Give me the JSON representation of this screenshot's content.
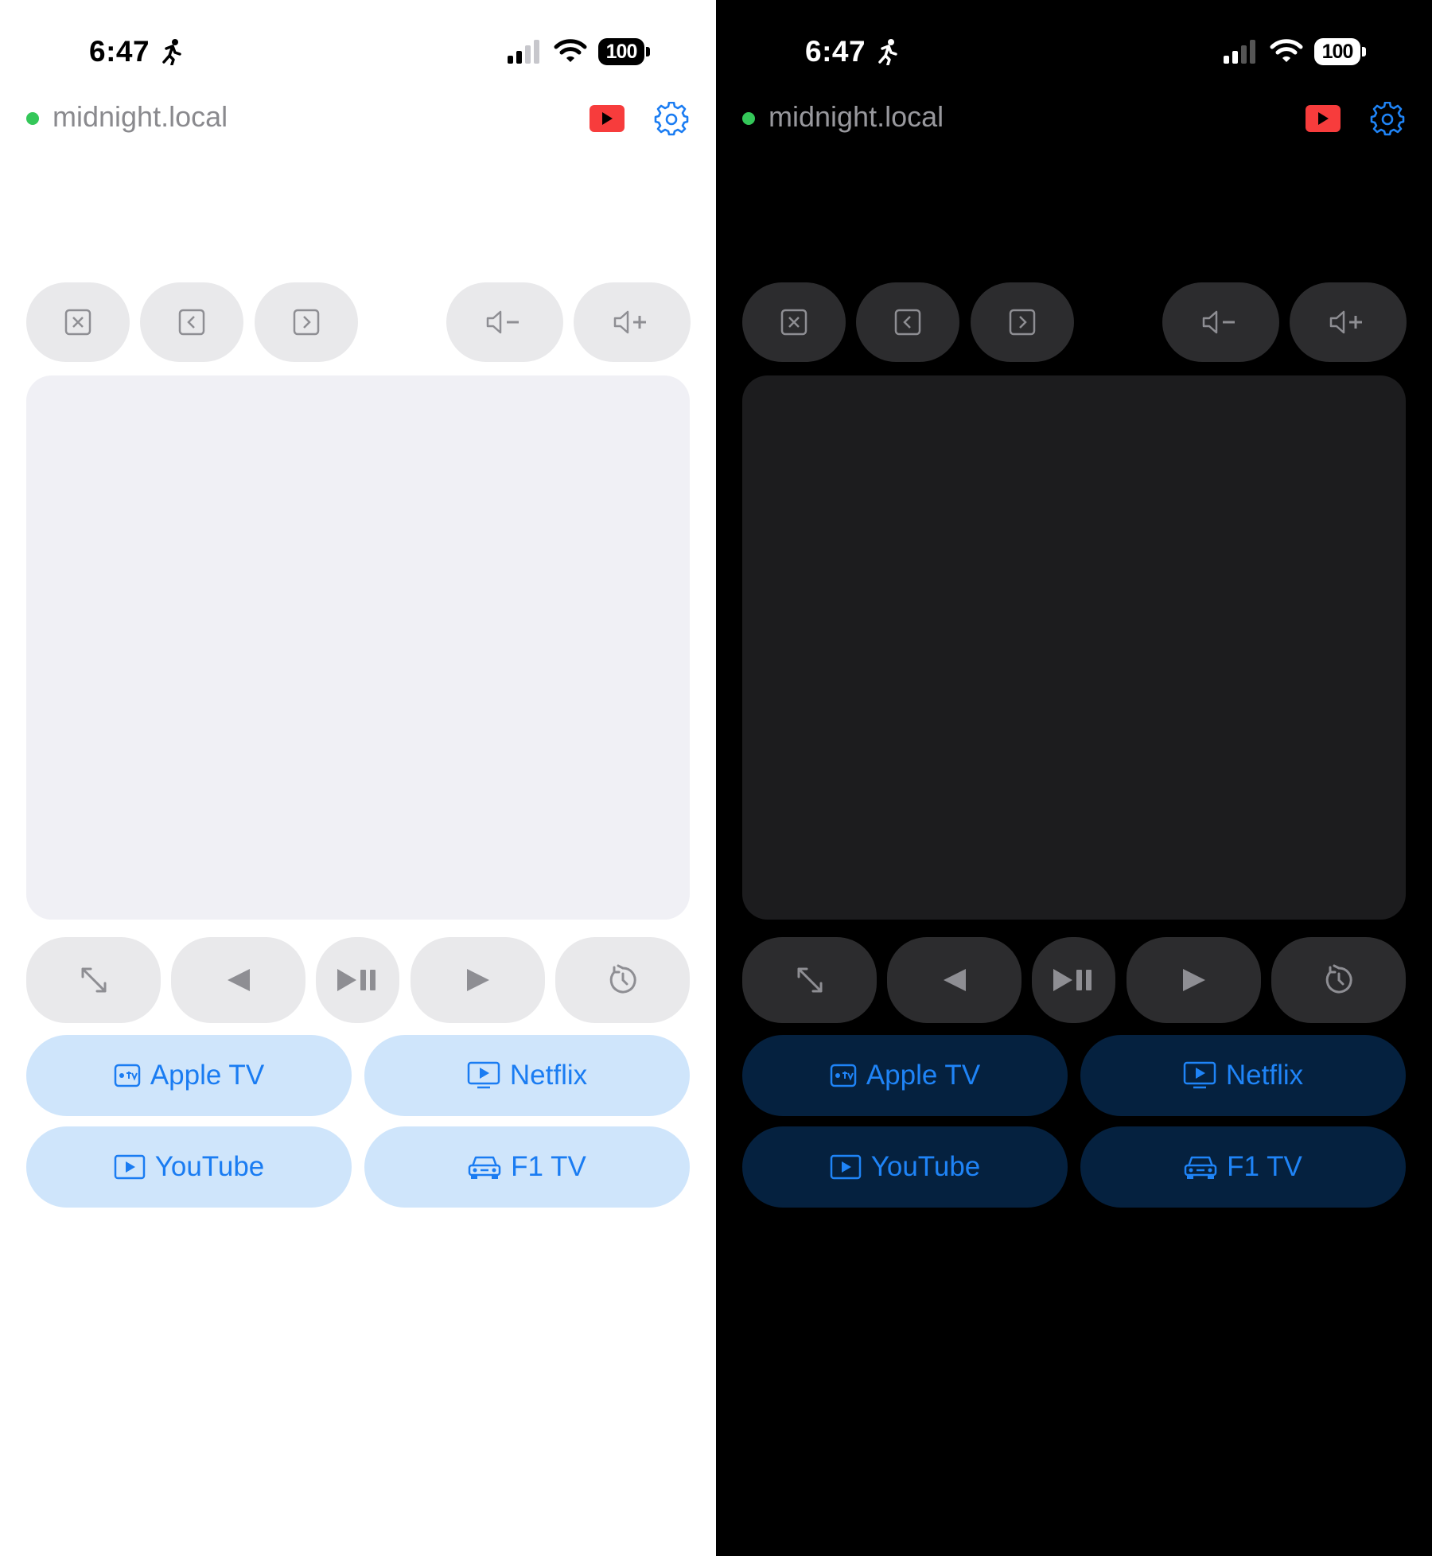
{
  "status_bar": {
    "time": "6:47",
    "battery": "100"
  },
  "host": {
    "name": "midnight.local"
  },
  "controls": {
    "top_row": [
      "close-icon",
      "back-icon",
      "forward-icon",
      "volume-down-icon",
      "volume-up-icon"
    ],
    "media_row": [
      "expand-icon",
      "previous-icon",
      "play-pause-icon",
      "next-icon",
      "replay-icon"
    ]
  },
  "apps": {
    "apple_tv": "Apple TV",
    "netflix": "Netflix",
    "youtube": "YouTube",
    "f1_tv": "F1 TV"
  },
  "colors": {
    "status_online": "#34c759",
    "youtube_red": "#f73c3c",
    "accent_blue": "#1a7cf2",
    "light_button_bg": "#e9e9eb",
    "dark_button_bg": "#2c2c2e",
    "light_app_bg": "#cfe5fb",
    "dark_app_bg": "#05213f"
  },
  "themes": [
    "light",
    "dark"
  ]
}
